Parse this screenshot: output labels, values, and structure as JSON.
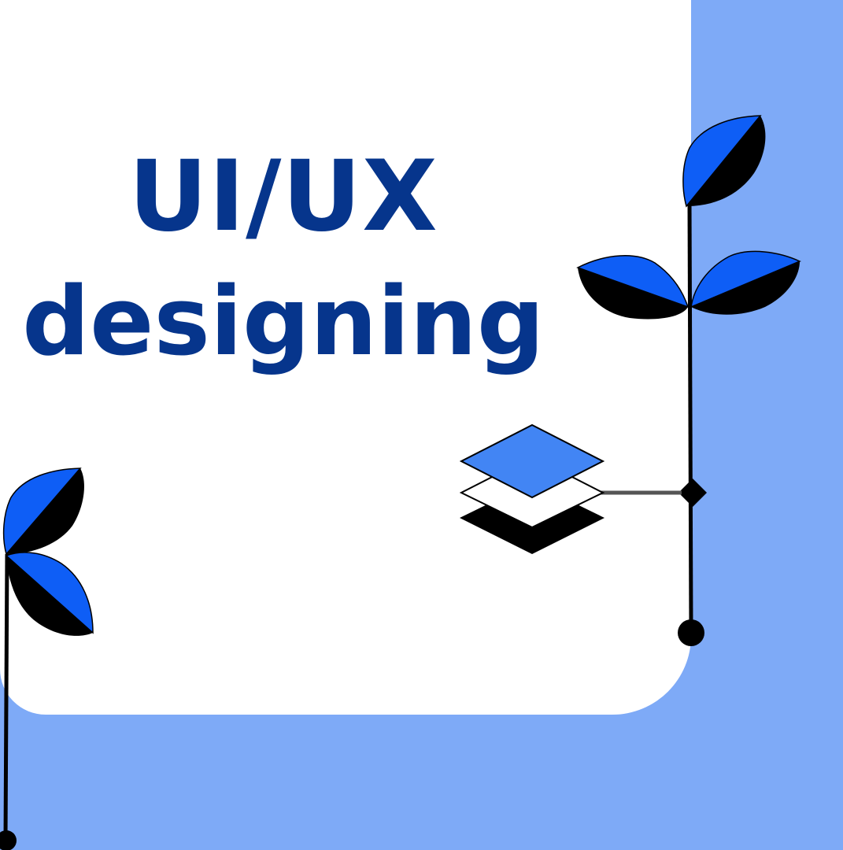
{
  "title": {
    "line1": "UI/UX",
    "line2": "designing"
  },
  "colors": {
    "background": "#7eaaf7",
    "card": "#ffffff",
    "title_text": "#06358c",
    "leaf_blue": "#0e5ef6",
    "layer_blue": "#4285f4",
    "stem": "#000000"
  },
  "icons": {
    "plant_right": "plant-illustration",
    "plant_left": "plant-illustration",
    "layers": "layers-stack-icon"
  }
}
